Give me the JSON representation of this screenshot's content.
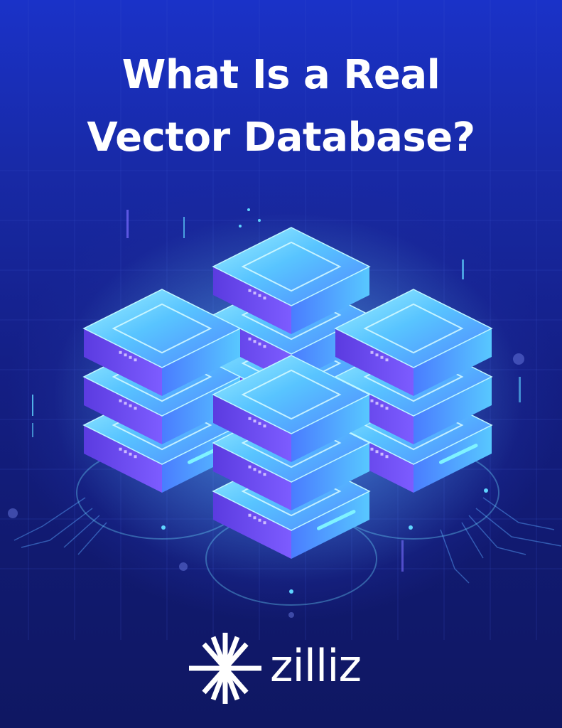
{
  "hero": {
    "title_line1": "What Is a Real",
    "title_line2": "Vector Database?"
  },
  "illustration": {
    "subject": "server-stack-icon",
    "stack_count": 4
  },
  "brand": {
    "logo_icon": "starburst-icon",
    "name": "zilliz"
  },
  "colors": {
    "background_top": "#1a32c8",
    "background_bottom": "#0f1762",
    "server_top": "#5fd0ff",
    "server_side": "#6a4cf0",
    "glow": "#7fe6ff",
    "text": "#ffffff"
  }
}
